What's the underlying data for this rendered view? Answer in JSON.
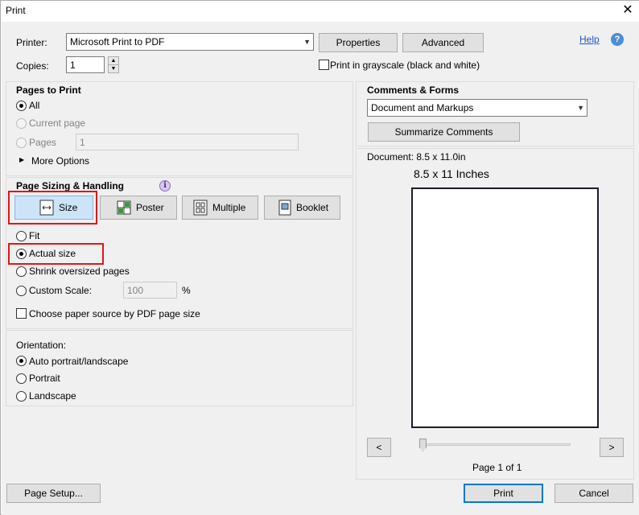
{
  "window": {
    "title": "Print",
    "close_glyph": "✕"
  },
  "printer": {
    "label": "Printer:",
    "value": "Microsoft Print to PDF",
    "properties_label": "Properties",
    "advanced_label": "Advanced",
    "help_label": "Help",
    "help_glyph": "?"
  },
  "copies": {
    "label": "Copies:",
    "value": "1",
    "up": "▲",
    "down": "▼"
  },
  "grayscale": {
    "label": "Print in grayscale (black and white)",
    "checked": false
  },
  "pages_to_print": {
    "title": "Pages to Print",
    "all_label": "All",
    "current_page_label": "Current page",
    "pages_label": "Pages",
    "pages_value": "1",
    "more_options_label": "More Options",
    "more_options_glyph": "▶"
  },
  "page_sizing": {
    "title": "Page Sizing & Handling",
    "info_glyph": "i",
    "modes": [
      {
        "label": "Size",
        "icon": "size-icon",
        "active": true
      },
      {
        "label": "Poster",
        "icon": "poster-icon",
        "active": false
      },
      {
        "label": "Multiple",
        "icon": "multiple-icon",
        "active": false
      },
      {
        "label": "Booklet",
        "icon": "booklet-icon",
        "active": false
      }
    ],
    "fit_label": "Fit",
    "actual_size_label": "Actual size",
    "shrink_label": "Shrink oversized pages",
    "custom_scale_label": "Custom Scale:",
    "custom_scale_value": "100",
    "percent_label": "%",
    "paper_source_label": "Choose paper source by PDF page size"
  },
  "orientation": {
    "title": "Orientation:",
    "auto_label": "Auto portrait/landscape",
    "portrait_label": "Portrait",
    "landscape_label": "Landscape"
  },
  "comments_forms": {
    "title": "Comments & Forms",
    "value": "Document and Markups",
    "summarize_label": "Summarize Comments"
  },
  "preview": {
    "document_size": "Document: 8.5 x 11.0in",
    "paper_size": "8.5 x 11 Inches",
    "prev_glyph": "<",
    "next_glyph": ">",
    "page_indicator": "Page 1 of 1",
    "slider_position": 0
  },
  "footer": {
    "page_setup_label": "Page Setup...",
    "print_label": "Print",
    "cancel_label": "Cancel"
  },
  "colors": {
    "highlight": "#e0161b",
    "accent": "#0078d7",
    "active_mode": "#cce4f7"
  }
}
